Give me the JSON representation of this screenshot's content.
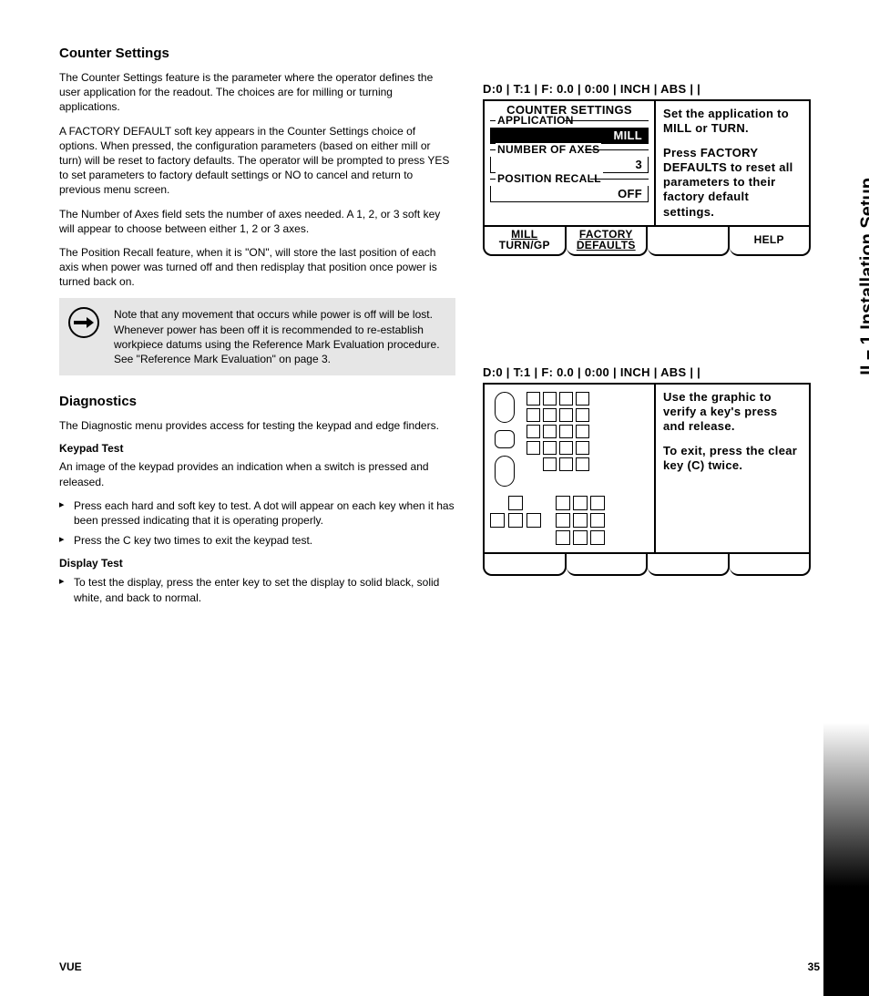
{
  "sideTab": "II – 1 Installation Setup",
  "footer": {
    "left": "VUE",
    "right": "35"
  },
  "sec1": {
    "heading": "Counter Settings",
    "p1": "The Counter Settings feature is the parameter where the operator defines the user application for the readout. The choices are for milling or turning applications.",
    "p2": "A FACTORY DEFAULT soft key appears in the Counter Settings choice of options. When pressed, the configuration parameters (based on either mill or turn) will be reset to factory defaults. The operator will be prompted to press YES to set parameters to factory default settings or NO to cancel and return to previous menu screen.",
    "p3": "The Number of Axes field sets the number of axes needed. A 1, 2, or 3 soft key will appear to choose between either 1, 2 or 3 axes.",
    "p4": "The Position Recall feature, when it is \"ON\", will store the last position of each axis when power was turned off and then redisplay that position once power is turned back on.",
    "note": "Note that any movement that occurs while power is off will be lost. Whenever power has been off it is recommended to re-establish workpiece datums using the Reference Mark Evaluation procedure. See \"Reference Mark Evaluation\" on page 3."
  },
  "sec2": {
    "heading": "Diagnostics",
    "p1": "The Diagnostic menu provides access for testing the keypad and edge finders.",
    "h_keypad": "Keypad Test",
    "p_keypad": "An image of the keypad provides an indication when a switch is pressed and released.",
    "b1": "Press each hard and soft key to test. A dot will appear on each key when it has been pressed indicating that it is operating properly.",
    "b2": "Press the C key two times to exit the keypad test.",
    "h_display": "Display Test",
    "b3": "To test the display, press the enter key to set the display to solid black, solid white, and back to normal."
  },
  "screen1": {
    "status": "D:0 | T:1 | F: 0.0 | 0:00 | INCH | ABS |   |",
    "title": "COUNTER SETTINGS",
    "f1_label": "APPLICATION",
    "f1_value": "MILL",
    "f2_label": "NUMBER OF AXES",
    "f2_value": "3",
    "f3_label": "POSITION RECALL",
    "f3_value": "OFF",
    "help1": "Set the application to MILL or TURN.",
    "help2": "Press FACTORY DEFAULTS to reset all parameters to their factory default settings.",
    "sk1a": "MILL",
    "sk1b": "TURN/GP",
    "sk2a": "FACTORY",
    "sk2b": "DEFAULTS",
    "sk4": "HELP"
  },
  "screen2": {
    "status": "D:0 | T:1 | F: 0.0 | 0:00 | INCH | ABS |   |",
    "help1": "Use the graphic to verify a key's press and release.",
    "help2": "To exit, press the clear key (C) twice."
  }
}
